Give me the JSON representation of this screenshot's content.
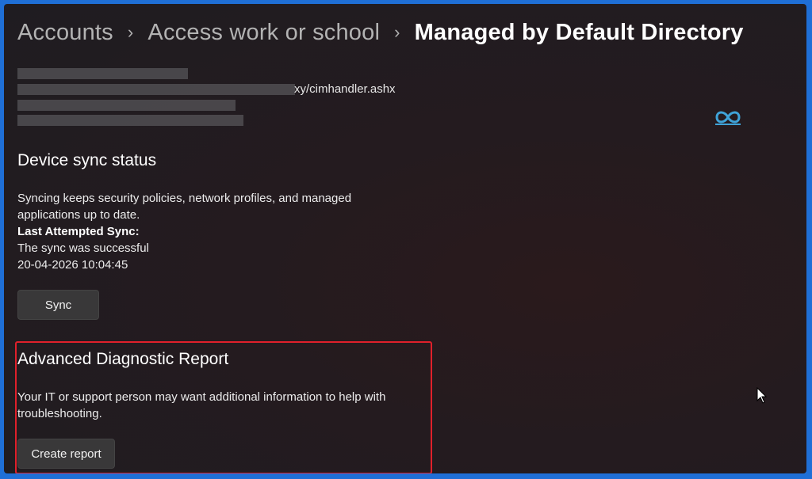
{
  "breadcrumb": {
    "items": [
      "Accounts",
      "Access work or school",
      "Managed by Default Directory"
    ],
    "separator": "›"
  },
  "server": {
    "url_tail": "xy/cimhandler.ashx"
  },
  "sync": {
    "heading": "Device sync status",
    "description_line1": "Syncing keeps security policies, network profiles, and managed",
    "description_line2": "applications up to date.",
    "last_label": "Last Attempted Sync:",
    "status": "The sync was successful",
    "timestamp": "20-04-2026 10:04:45",
    "button_label": "Sync"
  },
  "diagnostic": {
    "heading": "Advanced Diagnostic Report",
    "description_line1": "Your IT or support person may want additional information to help with",
    "description_line2": "troubleshooting.",
    "button_label": "Create report"
  },
  "colors": {
    "highlight": "#e0202b",
    "frame": "#1f6fd6",
    "logo": "#3fa3d8"
  },
  "icons": {
    "logo": "htmd-logo-icon",
    "cursor": "mouse-pointer-icon"
  }
}
